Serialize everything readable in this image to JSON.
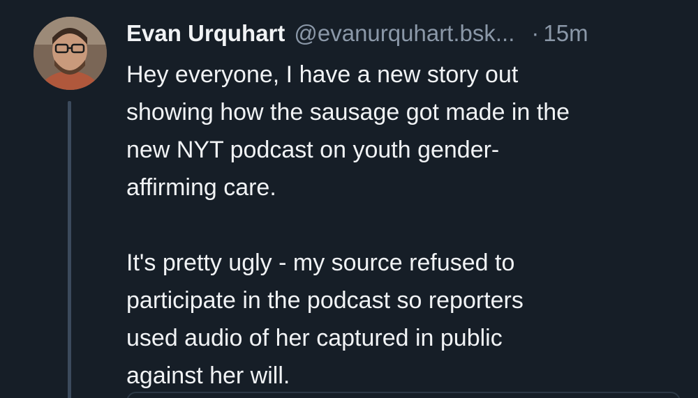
{
  "post": {
    "author": {
      "display_name": "Evan Urquhart",
      "handle": "@evanurquhart.bsk...",
      "avatar_icon": "avatar-photo"
    },
    "separator": "·",
    "time": "15m",
    "paragraphs": [
      [
        "Hey everyone, I have a new story out",
        "showing how the sausage got made in the",
        "new NYT podcast on youth gender-",
        "affirming care."
      ],
      [
        "It's pretty ugly - my source refused to",
        "participate in the podcast so reporters",
        "used audio of her captured in public",
        "against her will."
      ]
    ]
  },
  "colors": {
    "background": "#161e27",
    "primary_text": "#f1f3f5",
    "secondary_text": "#8b98a8",
    "thread_line": "#3b4a5c"
  }
}
